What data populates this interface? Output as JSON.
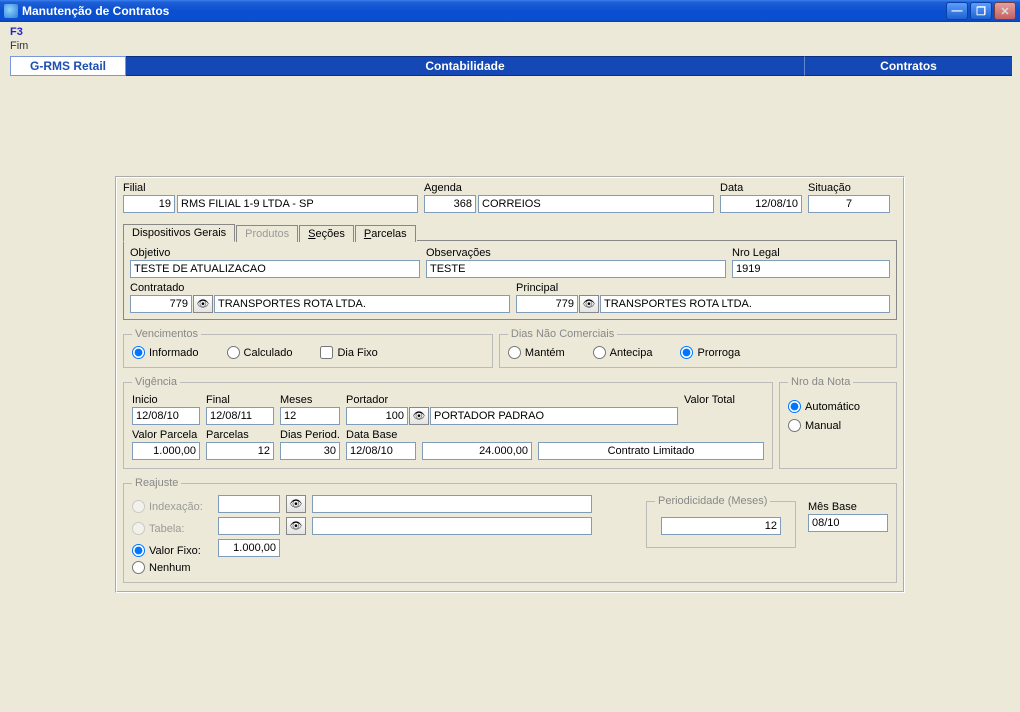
{
  "window": {
    "title": "Manutenção de Contratos"
  },
  "menu": {
    "f3": "F3",
    "fim": "Fim"
  },
  "ribbon": {
    "left": "G-RMS Retail",
    "mid": "Contabilidade",
    "right": "Contratos"
  },
  "header": {
    "filial_label": "Filial",
    "filial_num": "19",
    "filial_nome": "RMS FILIAL 1-9 LTDA - SP",
    "agenda_label": "Agenda",
    "agenda_num": "368",
    "agenda_nome": "CORREIOS",
    "data_label": "Data",
    "data_val": "12/08/10",
    "situacao_label": "Situação",
    "situacao_val": "7"
  },
  "tabs": {
    "dispositivos": "Dispositivos Gerais",
    "produtos": "Produtos",
    "secoes_pre": "S",
    "secoes_post": "eções",
    "parcelas_pre": "P",
    "parcelas_post": "arcelas"
  },
  "gerais": {
    "objetivo_label": "Objetivo",
    "objetivo_val": "TESTE DE ATUALIZACAO",
    "observ_label": "Observações",
    "observ_val": "TESTE",
    "nrolegal_label": "Nro Legal",
    "nrolegal_val": "1919",
    "contratado_label": "Contratado",
    "contratado_num": "779",
    "contratado_nome": "TRANSPORTES ROTA LTDA.",
    "principal_label": "Principal",
    "principal_num": "779",
    "principal_nome": "TRANSPORTES ROTA LTDA."
  },
  "vencimentos": {
    "legend": "Vencimentos",
    "informado": "Informado",
    "calculado": "Calculado",
    "diafixo": "Dia Fixo"
  },
  "dias": {
    "legend": "Dias Não Comerciais",
    "mantem": "Mantém",
    "antecipa": "Antecipa",
    "prorroga": "Prorroga"
  },
  "vigencia": {
    "legend": "Vigência",
    "inicio_label": "Inicio",
    "inicio_val": "12/08/10",
    "final_label": "Final",
    "final_val": "12/08/11",
    "meses_label": "Meses",
    "meses_val": "12",
    "portador_label": "Portador",
    "portador_num": "100",
    "portador_nome": "PORTADOR PADRAO",
    "valortotal_label": "Valor Total",
    "valorparcela_label": "Valor Parcela",
    "valorparcela_val": "1.000,00",
    "parcelas_label": "Parcelas",
    "parcelas_val": "12",
    "diasperiod_label": "Dias Period.",
    "diasperiod_val": "30",
    "database_label": "Data Base",
    "database_val": "12/08/10",
    "total_val": "24.000,00",
    "contrato_limitado": "Contrato Limitado"
  },
  "nronota": {
    "legend": "Nro da Nota",
    "automatico": "Automático",
    "manual": "Manual"
  },
  "reajuste": {
    "legend": "Reajuste",
    "indexacao": "Indexação:",
    "tabela": "Tabela:",
    "valorfixo": "Valor Fixo:",
    "valorfixo_val": "1.000,00",
    "nenhum": "Nenhum"
  },
  "periodicidade": {
    "legend": "Periodicidade (Meses)",
    "val": "12"
  },
  "mesbase": {
    "label": "Mês Base",
    "val": "08/10"
  }
}
